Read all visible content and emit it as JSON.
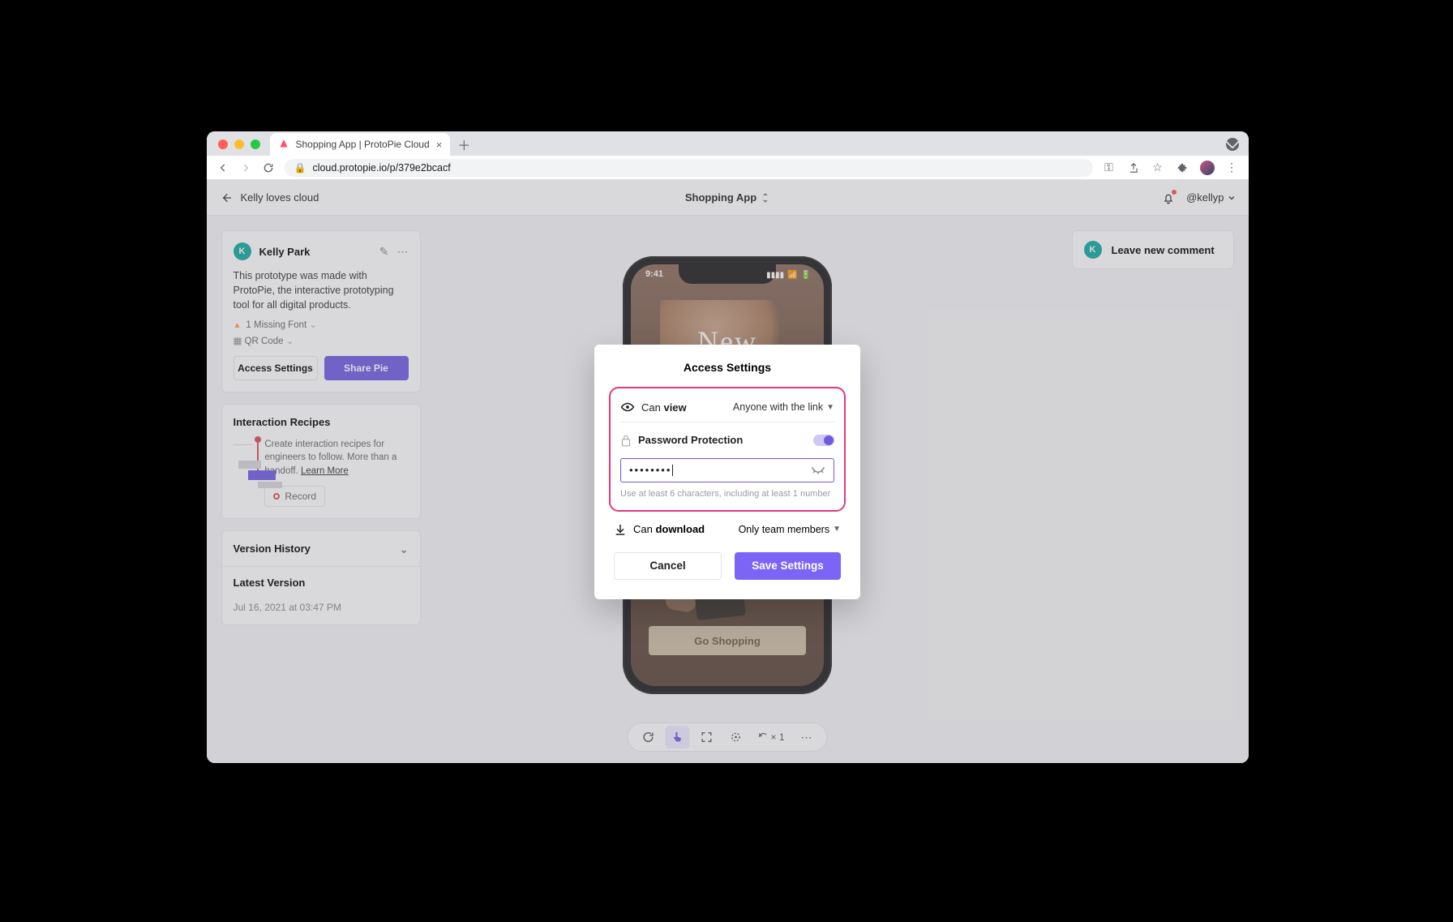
{
  "browser": {
    "tab_title": "Shopping App | ProtoPie Cloud",
    "url": "cloud.protopie.io/p/379e2bcacf"
  },
  "header": {
    "back_label": "Kelly loves cloud",
    "title": "Shopping App",
    "username": "@kellyp"
  },
  "info_card": {
    "avatar_initial": "K",
    "author": "Kelly Park",
    "description": "This prototype was made with ProtoPie, the interactive prototyping tool for all digital products.",
    "missing_font": "1 Missing Font",
    "qr_code": "QR Code",
    "access_btn": "Access Settings",
    "share_btn": "Share Pie"
  },
  "recipes": {
    "title": "Interaction Recipes",
    "text": "Create interaction recipes for engineers to follow. More than a handoff. ",
    "learn_more": "Learn More",
    "record": "Record"
  },
  "version": {
    "title": "Version History",
    "latest": "Latest Version",
    "date": "Jul 16, 2021 at 03:47 PM"
  },
  "comment": {
    "avatar_initial": "K",
    "text": "Leave new comment"
  },
  "phone": {
    "time": "9:41",
    "hero": "New",
    "cta": "Go Shopping"
  },
  "toolstrip": {
    "zoom": "× 1"
  },
  "modal": {
    "title": "Access Settings",
    "view_prefix": "Can ",
    "view_bold": "view",
    "view_dropdown": "Anyone with the link",
    "pw_label": "Password Protection",
    "pw_value": "••••••••",
    "pw_hint": "Use at least 6 characters, including at least 1 number",
    "download_prefix": "Can ",
    "download_bold": "download",
    "download_dropdown": "Only team members",
    "cancel": "Cancel",
    "save": "Save Settings"
  }
}
